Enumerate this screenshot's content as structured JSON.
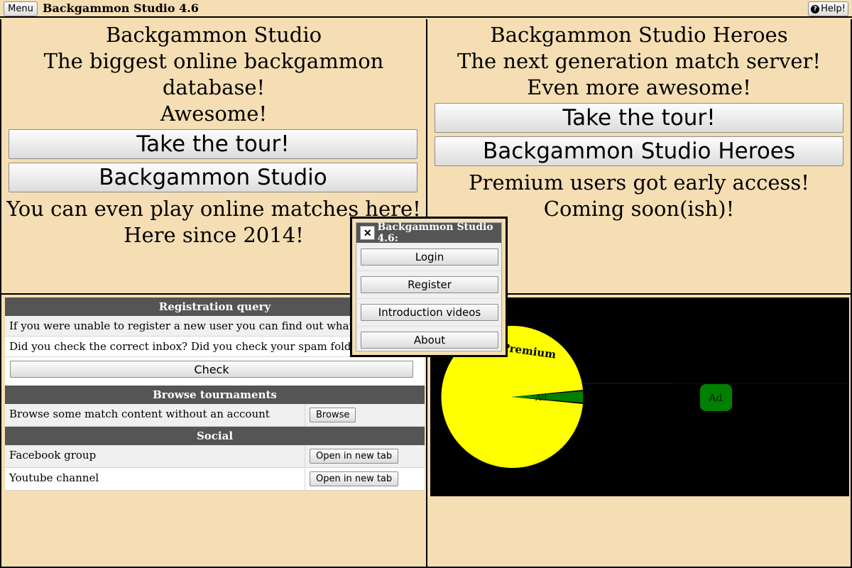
{
  "topbar": {
    "menu_label": "Menu",
    "title": "Backgammon Studio 4.6",
    "help_label": "Help!"
  },
  "left_promo": {
    "title": "Backgammon Studio",
    "tagline": "The biggest online backgammon database!",
    "note": "Awesome!",
    "tour_label": "Take the tour!",
    "open_label": "Backgammon Studio",
    "footer1": "You can even play online matches here!",
    "footer2": "Here since 2014!"
  },
  "right_promo": {
    "title": "Backgammon Studio Heroes",
    "tagline": "The next generation match server!",
    "note": "Even more awesome!",
    "tour_label": "Take the tour!",
    "open_label": "Backgammon Studio Heroes",
    "footer1": "Premium users got early access!",
    "footer2": "Coming soon(ish)!"
  },
  "registration": {
    "header": "Registration query",
    "line1": "If you were unable to register a new user you can find out what happened here.",
    "line2": "Did you check the correct inbox? Did you check your spam folder?",
    "check_label": "Check"
  },
  "browse": {
    "header": "Browse tournaments",
    "text": "Browse some match content without an account",
    "button_label": "Browse"
  },
  "social": {
    "header": "Social",
    "rows": [
      {
        "label": "Facebook group",
        "button_label": "Open in new tab"
      },
      {
        "label": "Youtube channel",
        "button_label": "Open in new tab"
      }
    ]
  },
  "ad_canvas": {
    "pie_label": "Premium",
    "slice_label": "Ad",
    "ad_badge": "Ad",
    "colors": {
      "pie": "#ffff00",
      "slice": "#008000",
      "background": "#000000"
    }
  },
  "popup": {
    "close_icon": "✕",
    "title": "Backgammon Studio 4.6:",
    "buttons": [
      "Login",
      "Register",
      "Introduction videos",
      "About"
    ]
  }
}
